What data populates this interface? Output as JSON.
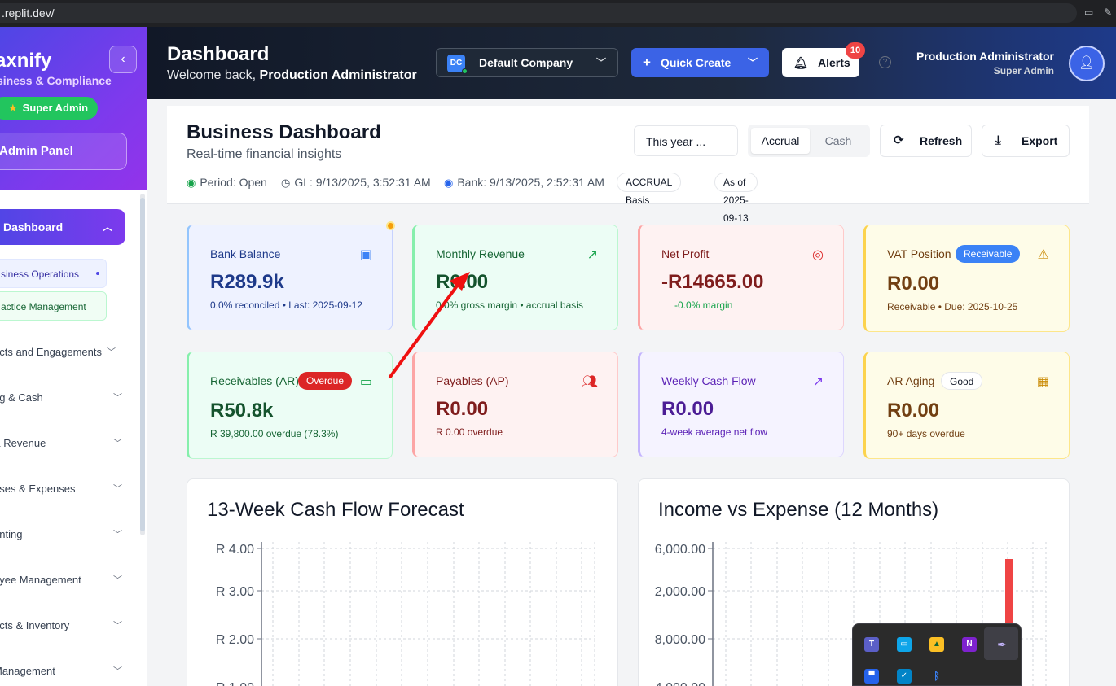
{
  "browser": {
    "url": ".replit.dev/"
  },
  "sidebar": {
    "brand": "axnify",
    "brand_sub": "siness & Compliance",
    "collapse_icon": "chevron-left-icon",
    "role_badge": "Super Admin",
    "admin_panel": "Admin Panel",
    "dashboard": "Dashboard",
    "sub_items": [
      "siness Operations",
      "actice Management"
    ],
    "items": [
      "acts and Engagements",
      "ng & Cash",
      "& Revenue",
      "ases & Expenses",
      "unting",
      "oyee Management",
      "ucts & Inventory",
      "Management"
    ]
  },
  "header": {
    "title": "Dashboard",
    "welcome_prefix": "Welcome back, ",
    "welcome_name": "Production Administrator",
    "company_initials": "DC",
    "company": "Default Company",
    "quick_create": "Quick Create",
    "alerts": "Alerts",
    "alerts_count": "10",
    "user_name": "Production Administrator",
    "user_role": "Super Admin"
  },
  "business": {
    "title": "Business Dashboard",
    "subtitle": "Real-time financial insights",
    "period_value": "This year ...",
    "basis_options": [
      "Accrual",
      "Cash"
    ],
    "basis_selected": "Accrual",
    "refresh": "Refresh",
    "export": "Export",
    "period_status": "Period: Open",
    "gl": "GL: 9/13/2025, 3:52:31 AM",
    "bank": "Bank: 9/13/2025, 2:52:31 AM",
    "basis_pill": "ACCRUAL Basis",
    "as_of_pill": "As of 2025-09-13"
  },
  "kpis": {
    "bank_balance": {
      "label": "Bank Balance",
      "value": "R289.9k",
      "sub": "0.0% reconciled • Last: 2025-09-12"
    },
    "monthly_revenue": {
      "label": "Monthly Revenue",
      "value": "R0.00",
      "sub": "0.0% gross margin • accrual basis"
    },
    "net_profit": {
      "label": "Net Profit",
      "value": "-R14665.00",
      "sub": "-0.0% margin"
    },
    "vat_position": {
      "label": "VAT Position",
      "badge": "Receivable",
      "value": "R0.00",
      "sub": "Receivable • Due: 2025-10-25"
    },
    "receivables": {
      "label": "Receivables (AR)",
      "badge": "Overdue",
      "value": "R50.8k",
      "sub": "R 39,800.00 overdue (78.3%)"
    },
    "payables": {
      "label": "Payables (AP)",
      "value": "R0.00",
      "sub": "R 0.00 overdue"
    },
    "weekly_cash_flow": {
      "label": "Weekly Cash Flow",
      "value": "R0.00",
      "sub": "4-week average net flow"
    },
    "ar_aging": {
      "label": "AR Aging",
      "badge": "Good",
      "value": "R0.00",
      "sub": "90+ days overdue"
    }
  },
  "charts": {
    "cash_flow_title": "13-Week Cash Flow Forecast",
    "income_expense_title": "Income vs Expense (12 Months)"
  },
  "chart_data": [
    {
      "type": "line",
      "title": "13-Week Cash Flow Forecast",
      "y_ticks": [
        "R 4.00",
        "R 3.00",
        "R 2.00",
        "R 1.00"
      ],
      "ylim": [
        1,
        4
      ],
      "grid": true,
      "series": []
    },
    {
      "type": "bar",
      "title": "Income vs Expense (12 Months)",
      "y_ticks": [
        "6,000.00",
        "2,000.00",
        "8,000.00",
        "4,000.00"
      ],
      "grid": true,
      "series": [],
      "colors": {
        "expense": "#ef4444"
      }
    }
  ],
  "taskbar": {
    "icons": [
      "teams-icon",
      "screen-icon",
      "drive-icon",
      "onenote-icon",
      "pen-icon",
      "window-icon",
      "defender-icon",
      "bluetooth-icon"
    ]
  },
  "colors": {
    "accent": "#3b63e6",
    "sidebar_gradient_start": "#4f46e5",
    "sidebar_gradient_end": "#9333ea",
    "annotation_arrow": "#ef1010"
  }
}
